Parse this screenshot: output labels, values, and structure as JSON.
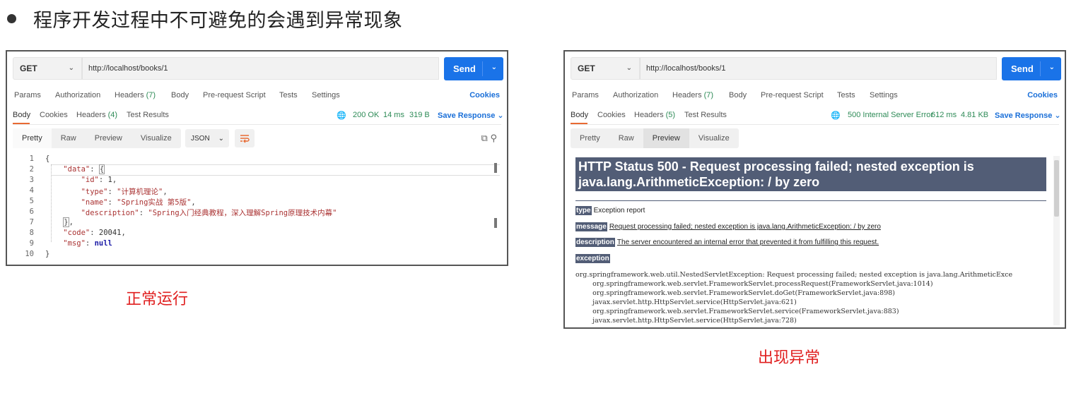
{
  "heading": "程序开发过程中不可避免的会遇到异常现象",
  "left": {
    "method": "GET",
    "url": "http://localhost/books/1",
    "send": "Send",
    "tabs": {
      "params": "Params",
      "auth": "Authorization",
      "headers": "Headers",
      "headers_count": "(7)",
      "body": "Body",
      "prereq": "Pre-request Script",
      "tests": "Tests",
      "settings": "Settings",
      "cookies": "Cookies"
    },
    "resp_tabs": {
      "body": "Body",
      "cookies": "Cookies",
      "headers": "Headers",
      "headers_count": "(4)",
      "results": "Test Results"
    },
    "status": "200 OK",
    "time": "14 ms",
    "size": "319 B",
    "save": "Save Response",
    "views": [
      "Pretty",
      "Raw",
      "Preview",
      "Visualize"
    ],
    "format": "JSON",
    "line_numbers": [
      "1",
      "2",
      "3",
      "4",
      "5",
      "6",
      "7",
      "8",
      "9",
      "10"
    ]
  },
  "right": {
    "method": "GET",
    "url": "http://localhost/books/1",
    "send": "Send",
    "tabs": {
      "params": "Params",
      "auth": "Authorization",
      "headers": "Headers",
      "headers_count": "(7)",
      "body": "Body",
      "prereq": "Pre-request Script",
      "tests": "Tests",
      "settings": "Settings",
      "cookies": "Cookies"
    },
    "resp_tabs": {
      "body": "Body",
      "cookies": "Cookies",
      "headers": "Headers",
      "headers_count": "(5)",
      "results": "Test Results"
    },
    "status": "500 Internal Server Error",
    "time": "612 ms",
    "size": "4.81 KB",
    "save": "Save Response",
    "views": [
      "Pretty",
      "Raw",
      "Preview",
      "Visualize"
    ],
    "error_title": "HTTP Status 500 - Request processing failed; nested exception is java.lang.ArithmeticException: / by zero",
    "type_label": "type",
    "type_value": "Exception report",
    "message_label": "message",
    "message_value": "Request processing failed; nested exception is java.lang.ArithmeticException: / by zero",
    "description_label": "description",
    "description_value": "The server encountered an internal error that prevented it from fulfilling this request.",
    "exception_label": "exception",
    "trace": "org.springframework.web.util.NestedServletException: Request processing failed; nested exception is java.lang.ArithmeticExce\n\torg.springframework.web.servlet.FrameworkServlet.processRequest(FrameworkServlet.java:1014)\n\torg.springframework.web.servlet.FrameworkServlet.doGet(FrameworkServlet.java:898)\n\tjavax.servlet.http.HttpServlet.service(HttpServlet.java:621)\n\torg.springframework.web.servlet.FrameworkServlet.service(FrameworkServlet.java:883)\n\tjavax.servlet.http.HttpServlet.service(HttpServlet.java:728)"
  },
  "caption_left": "正常运行",
  "caption_right": "出现异常"
}
